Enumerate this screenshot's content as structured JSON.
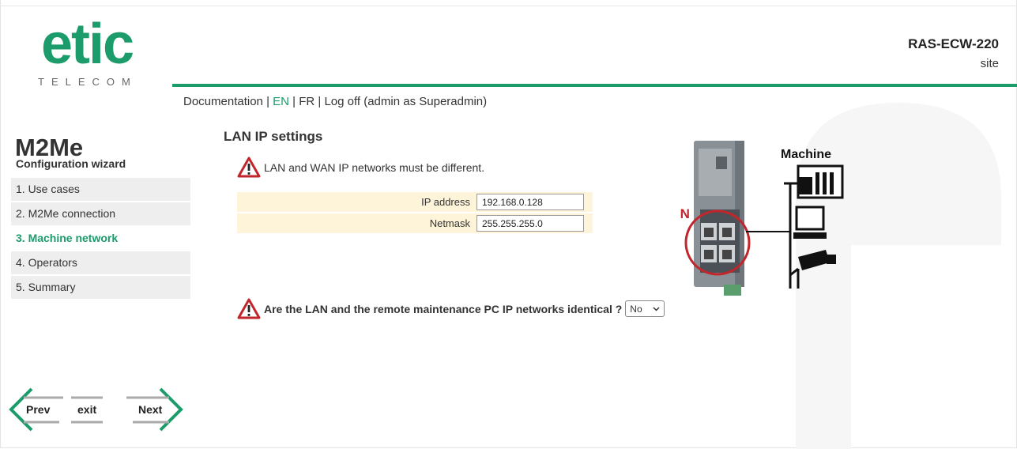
{
  "header": {
    "logo_word": "etic",
    "logo_sub": "TELECOM",
    "device_name": "RAS-ECW-220",
    "site": "site"
  },
  "topnav": {
    "documentation": "Documentation",
    "en": "EN",
    "fr": "FR",
    "logoff": "Log off (admin as Superadmin)",
    "separator": " | "
  },
  "wizard": {
    "logo_text": "M2Me",
    "title": "Configuration wizard",
    "steps": [
      {
        "label": "1. Use cases",
        "active": false
      },
      {
        "label": "2. M2Me connection",
        "active": false
      },
      {
        "label": "3. Machine network",
        "active": true
      },
      {
        "label": "4. Operators",
        "active": false
      },
      {
        "label": "5. Summary",
        "active": false
      }
    ]
  },
  "main": {
    "title": "LAN IP settings",
    "warning_networks": "LAN and WAN IP networks must be different.",
    "ip_label": "IP address",
    "ip_value": "192.168.0.128",
    "netmask_label": "Netmask",
    "netmask_value": "255.255.255.0",
    "question": "Are the LAN and the remote maintenance PC IP networks identical ?",
    "question_value": "No"
  },
  "diagram": {
    "lan_label": "LAN",
    "machine_label": "Machine"
  },
  "navigation": {
    "prev": "Prev",
    "exit": "exit",
    "next": "Next"
  },
  "colors": {
    "brand_green": "#1b9c6a",
    "warning_red": "#c0262c",
    "form_row_bg": "#fdf4d9"
  },
  "icons": [
    "warning-icon",
    "prev-arrow-icon",
    "next-arrow-icon",
    "chevron-down-icon"
  ]
}
